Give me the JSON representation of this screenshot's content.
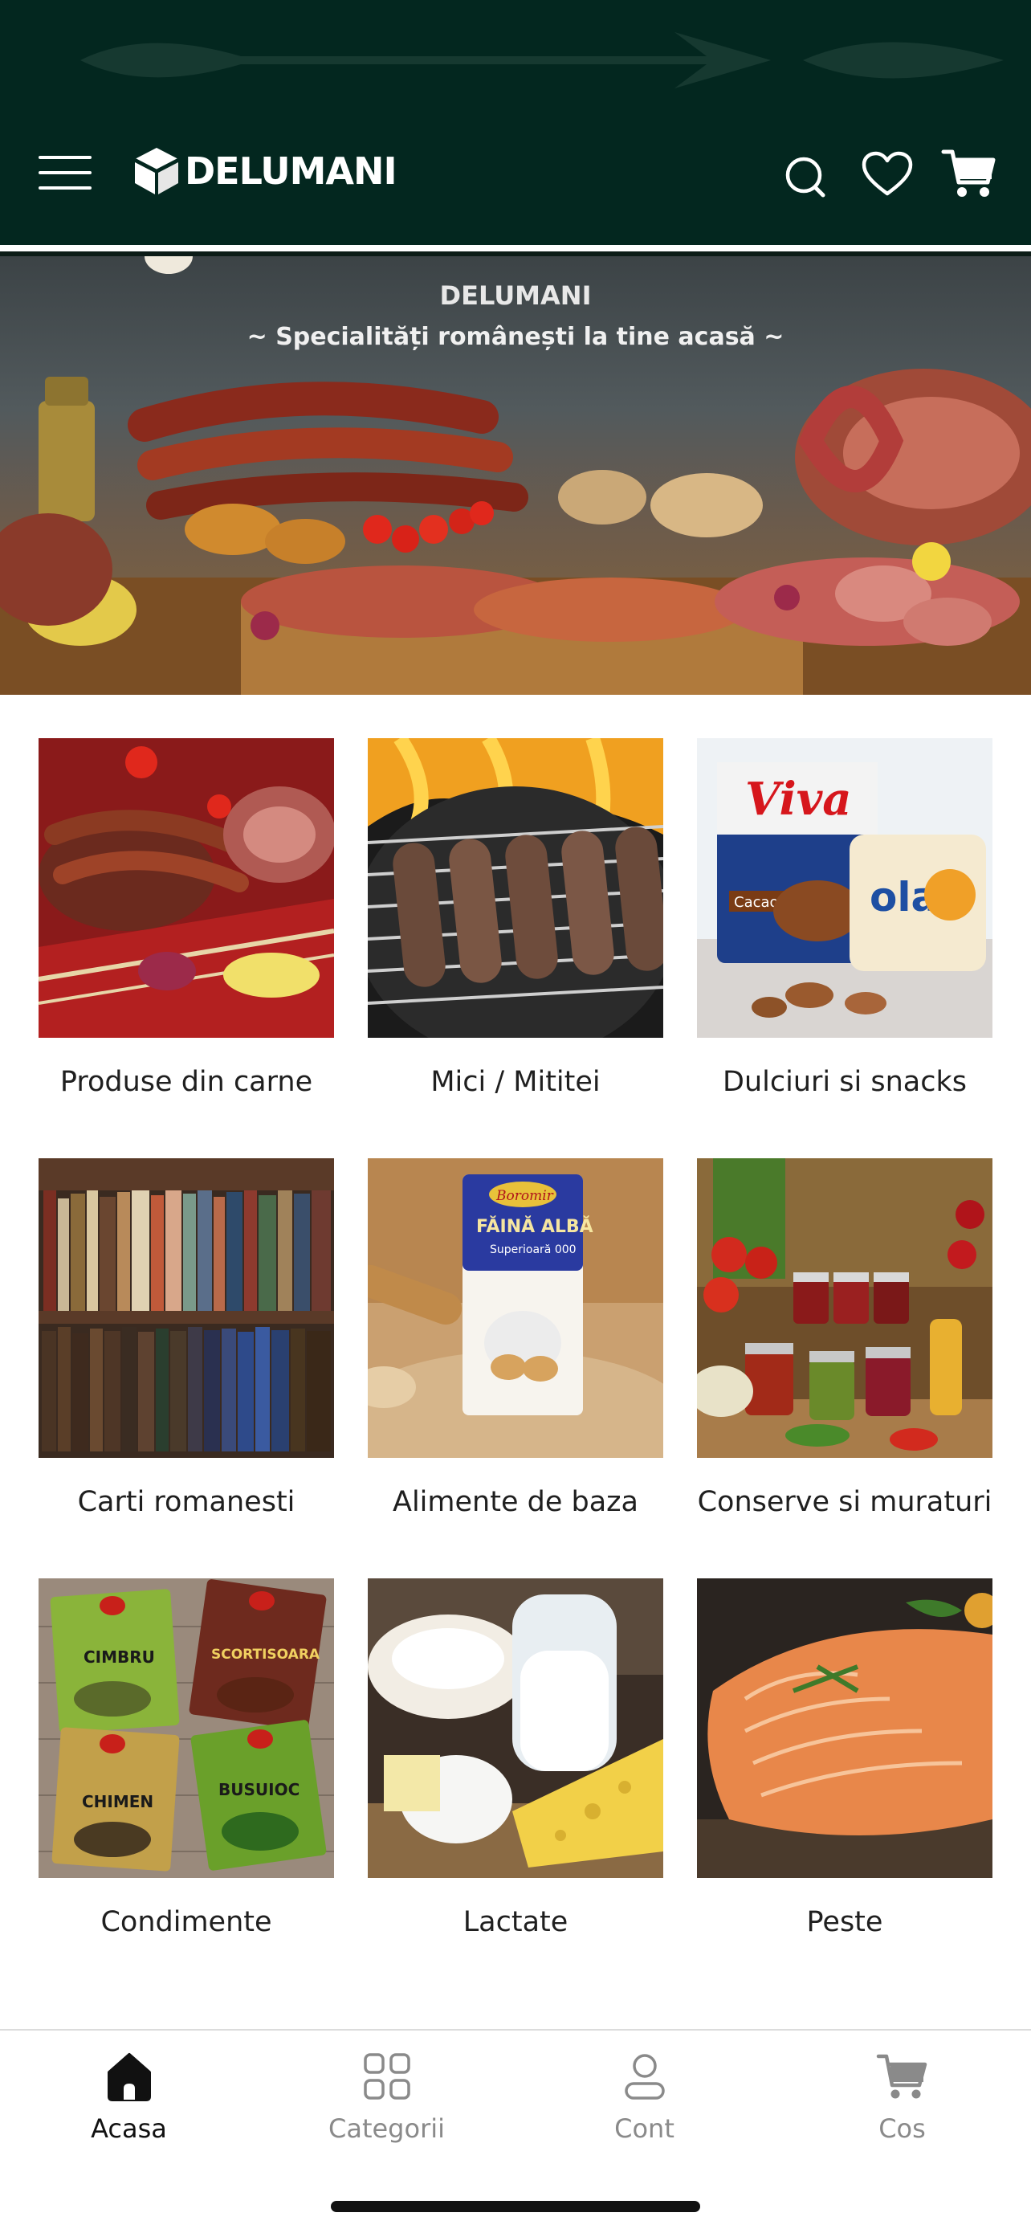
{
  "app": {
    "name": "DELUMANI"
  },
  "header": {
    "logo_text": "DELUMANI",
    "icons": [
      "menu-icon",
      "search-icon",
      "heart-icon",
      "cart-icon"
    ],
    "background": "#03271f"
  },
  "banner": {
    "title": "DELUMANI",
    "subtitle": "~ Specialități românești la tine acasă ~"
  },
  "categories": [
    {
      "label": "Produse din carne"
    },
    {
      "label": "Mici / Mititei"
    },
    {
      "label": "Dulciuri si snacks"
    },
    {
      "label": "Carti romanesti"
    },
    {
      "label": "Alimente de baza"
    },
    {
      "label": "Conserve si muraturi"
    },
    {
      "label": "Condimente"
    },
    {
      "label": "Lactate"
    },
    {
      "label": "Peste"
    }
  ],
  "bottom_nav": {
    "items": [
      {
        "label": "Acasa",
        "icon": "home-icon",
        "active": true
      },
      {
        "label": "Categorii",
        "icon": "grid-icon",
        "active": false
      },
      {
        "label": "Cont",
        "icon": "user-icon",
        "active": false
      },
      {
        "label": "Cos",
        "icon": "cart-icon",
        "active": false
      }
    ]
  }
}
